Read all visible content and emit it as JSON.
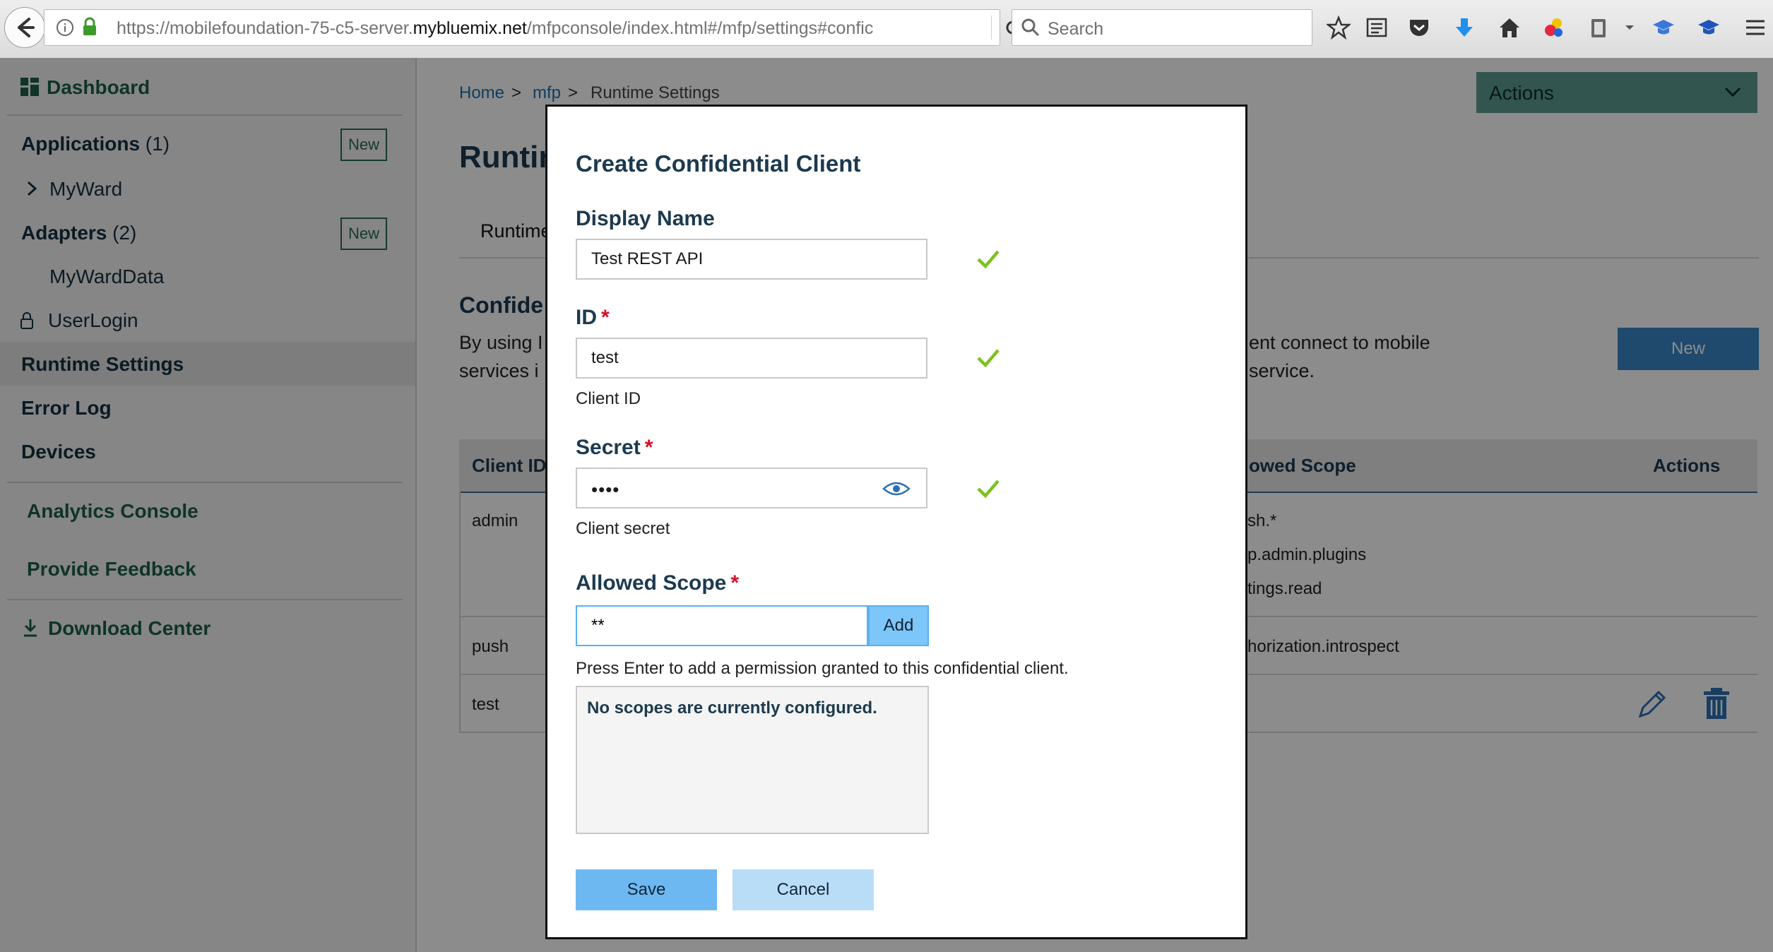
{
  "browser": {
    "url_prefix": "https://mobilefoundation-75-c5-server.",
    "url_domain": "mybluemix.net",
    "url_suffix": "/mfpconsole/index.html#/mfp/settings#confic",
    "search_placeholder": "Search"
  },
  "sidebar": {
    "dashboard": "Dashboard",
    "applications": "Applications",
    "applications_count": "(1)",
    "new_label": "New",
    "app_items": [
      "MyWard"
    ],
    "adapters": "Adapters",
    "adapters_count": "(2)",
    "adapter_items": [
      "MyWardData",
      "UserLogin"
    ],
    "runtime_settings": "Runtime Settings",
    "error_log": "Error Log",
    "devices": "Devices",
    "analytics_console": "Analytics Console",
    "provide_feedback": "Provide Feedback",
    "download_center": "Download Center"
  },
  "main": {
    "breadcrumb": [
      "Home",
      "mfp",
      "Runtime Settings"
    ],
    "breadcrumb_sep": ">",
    "actions_label": "Actions",
    "page_title_partial": "Runtir",
    "tab_partial": "Runtime",
    "section_partial": "Confide",
    "desc_left_1": "By using I",
    "desc_left_2": "services i",
    "desc_right_1": "ent connect to mobile",
    "desc_right_2": "service.",
    "new_button": "New",
    "table": {
      "col_client_id": "Client ID",
      "col_scope_partial": "owed Scope",
      "col_actions": "Actions",
      "rows": [
        {
          "client_id": "admin",
          "scopes": [
            "sh.*",
            "p.admin.plugins",
            "tings.read"
          ]
        },
        {
          "client_id": "push",
          "scopes": [
            "horization.introspect"
          ]
        },
        {
          "client_id": "test",
          "scopes": []
        }
      ]
    }
  },
  "modal": {
    "title": "Create Confidential Client",
    "display_name_label": "Display Name",
    "display_name_value": "Test REST API",
    "id_label": "ID",
    "id_value": "test",
    "id_help": "Client ID",
    "secret_label": "Secret",
    "secret_value": "••••",
    "secret_help": "Client secret",
    "scope_label": "Allowed Scope",
    "scope_value": "**",
    "add_button": "Add",
    "scope_help": "Press Enter to add a permission granted to this confidential client.",
    "scopes_empty": "No scopes are currently configured.",
    "save_button": "Save",
    "cancel_button": "Cancel",
    "required_mark": "*",
    "colors": {
      "check": "#7cc21e",
      "primary": "#6eb8f2",
      "required": "#d3102a"
    }
  }
}
